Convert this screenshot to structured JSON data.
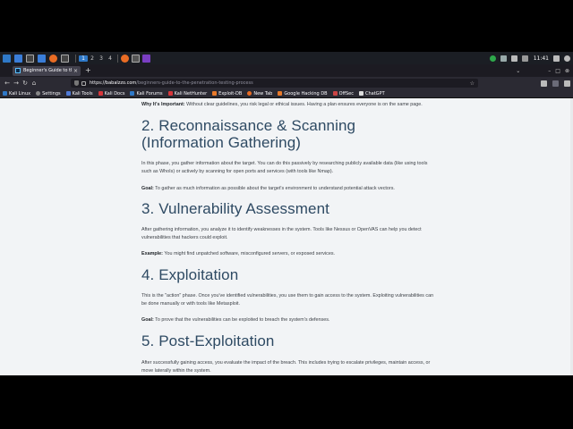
{
  "taskbar": {
    "workspaces": [
      "1",
      "2",
      "3",
      "4"
    ],
    "clock": "11:41"
  },
  "browser": {
    "tab_title": "Beginner's Guide to the P",
    "new_tab": "+",
    "tab_close": "×",
    "url_host": "https://babalzzo.com",
    "url_path": "/beginners-guide-to-the-penetration-testing-process",
    "bookmarks": [
      "Kali Linux",
      "Settings",
      "Kali Tools",
      "Kali Docs",
      "Kali Forums",
      "Kali NetHunter",
      "Exploit-DB",
      "New Tab",
      "Google Hacking DB",
      "OffSec",
      "ChatGPT"
    ]
  },
  "article": {
    "intro_bold": "Why It's Important:",
    "intro_text": " Without clear guidelines, you risk legal or ethical issues. Having a plan ensures everyone is on the same page.",
    "sections": [
      {
        "heading_line1": "2. Reconnaissance & Scanning",
        "heading_line2": "(Information Gathering)",
        "body": "In this phase, you gather information about the target. You can do this passively by researching publicly available data (like using tools such as WhoIs) or actively by scanning for open ports and services (with tools like Nmap).",
        "note_bold": "Goal:",
        "note_text": " To gather as much information as possible about the target's environment to understand potential attack vectors."
      },
      {
        "heading_line1": "3. Vulnerability Assessment",
        "body": "After gathering information, you analyze it to identify weaknesses in the system. Tools like Nessus or OpenVAS can help you detect vulnerabilities that hackers could exploit.",
        "note_bold": "Example:",
        "note_text": " You might find unpatched software, misconfigured servers, or exposed services."
      },
      {
        "heading_line1": "4. Exploitation",
        "body": "This is the \"action\" phase. Once you've identified vulnerabilities, you use them to gain access to the system. Exploiting vulnerabilities can be done manually or with tools like Metasploit.",
        "note_bold": "Goal:",
        "note_text": " To prove that the vulnerabilities can be exploited to breach the system's defenses."
      },
      {
        "heading_line1": "5. Post-Exploitation",
        "body": "After successfully gaining access, you evaluate the impact of the breach. This includes trying to escalate privileges, maintain access, or move laterally within the system."
      }
    ]
  },
  "colors": {
    "heading": "#2e4a63",
    "page_bg": "#f2f4f6",
    "tab_bg": "#42414d",
    "toolbar_bg": "#2b2a33"
  }
}
